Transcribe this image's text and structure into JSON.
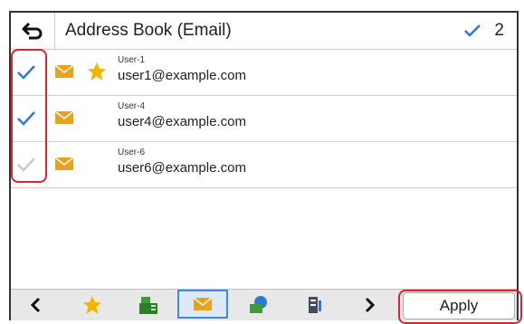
{
  "header": {
    "title": "Address Book (Email)",
    "selected_count": "2"
  },
  "entries": [
    {
      "name": "User-1",
      "email": "user1@example.com",
      "checked": true,
      "favorite": true
    },
    {
      "name": "User-4",
      "email": "user4@example.com",
      "checked": true,
      "favorite": false
    },
    {
      "name": "User-6",
      "email": "user6@example.com",
      "checked": false,
      "favorite": false
    }
  ],
  "toolbar": {
    "items": [
      "prev-arrow-icon",
      "favorites-star-icon",
      "fax-icon",
      "email-envelope-icon",
      "shared-folder-icon",
      "server-icon",
      "next-arrow-icon"
    ],
    "apply_label": "Apply"
  },
  "colors": {
    "check_active": "#2b7bd6",
    "check_inactive": "#c9c9c9",
    "mail_icon": "#e8a21c",
    "star_icon": "#f4b400",
    "highlight": "#e0242f"
  }
}
